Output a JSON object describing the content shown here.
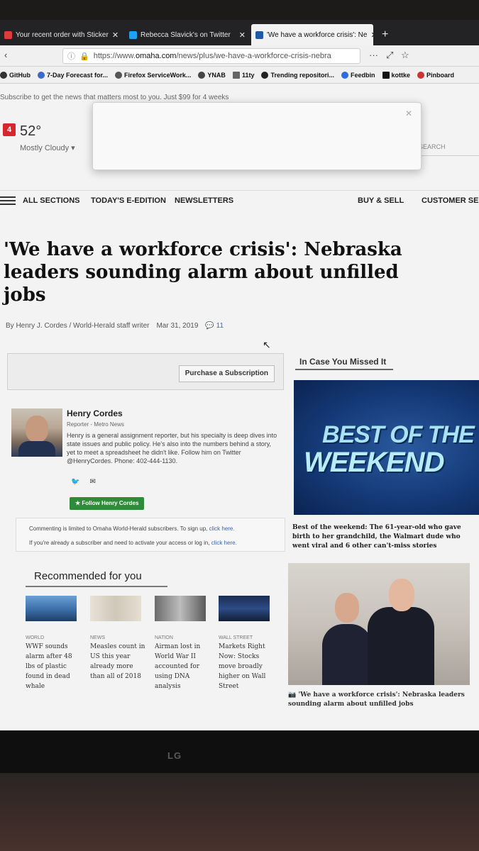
{
  "browser": {
    "tabs": [
      {
        "label": "Your recent order with Sticker",
        "active": false
      },
      {
        "label": "Rebecca Slavick's on Twitter",
        "active": false
      },
      {
        "label": "'We have a workforce crisis': Ne",
        "active": true
      }
    ],
    "url_prefix": "https://www.",
    "url_host": "omaha.com",
    "url_path": "/news/plus/we-have-a-workforce-crisis-nebra",
    "bookmarks": [
      "GitHub",
      "7-Day Forecast for...",
      "Firefox ServiceWork...",
      "YNAB",
      "11ty",
      "Trending repositori...",
      "Feedbin",
      "kottke",
      "Pinboard"
    ]
  },
  "header": {
    "subscribe_text": "Subscribe to get the news that matters most to you. Just $99 for 4 weeks",
    "weather_temp": "52°",
    "weather_condition": "Mostly Cloudy",
    "alert_count": "4",
    "search_placeholder": "SEARCH"
  },
  "nav": {
    "left": [
      "ALL SECTIONS",
      "TODAY'S E-EDITION",
      "NEWSLETTERS"
    ],
    "right": [
      "BUY & SELL",
      "CUSTOMER SER"
    ]
  },
  "article": {
    "headline": "'We have a workforce crisis': Nebraska leaders sounding alarm about unfilled jobs",
    "byline": "By Henry J. Cordes / World-Herald staff writer",
    "date": "Mar 31, 2019",
    "comment_count": "11",
    "subscribe_button": "Purchase a Subscription"
  },
  "author": {
    "name": "Henry Cordes",
    "role": "Reporter - Metro News",
    "bio": "Henry is a general assignment reporter, but his specialty is deep dives into state issues and public policy. He's also into the numbers behind a story, yet to meet a spreadsheet he didn't like. Follow him on Twitter @HenryCordes. Phone: 402-444-1130.",
    "follow_label": "Follow Henry Cordes"
  },
  "commenting": {
    "line1_text": "Commenting is limited to Omaha World-Herald subscribers. To sign up, ",
    "line1_link": "click here.",
    "line2_text": "If you're already a subscriber and need to activate your access or log in, ",
    "line2_link": "click here."
  },
  "recommended": {
    "title": "Recommended for you",
    "items": [
      {
        "category": "World",
        "text": "WWF sounds alarm after 48 lbs of plastic found in dead whale"
      },
      {
        "category": "News",
        "text": "Measles count in US this year already more than all of 2018"
      },
      {
        "category": "Nation",
        "text": "Airman lost in World War II accounted for using DNA analysis"
      },
      {
        "category": "Wall Street",
        "text": "Markets Right Now: Stocks move broadly higher on Wall Street"
      }
    ]
  },
  "sidebar": {
    "title": "In Case You Missed It",
    "promo_line1": "BEST OF THE",
    "promo_line2": "WEEKEND",
    "promo_caption": "Best of the weekend: The 61-year-old who gave birth to her grandchild, the Walmart dude who went viral and 6 other can't-miss stories",
    "photo_caption": "'We have a workforce crisis': Nebraska leaders sounding alarm about unfilled jobs"
  },
  "monitor": {
    "brand": "LG"
  }
}
